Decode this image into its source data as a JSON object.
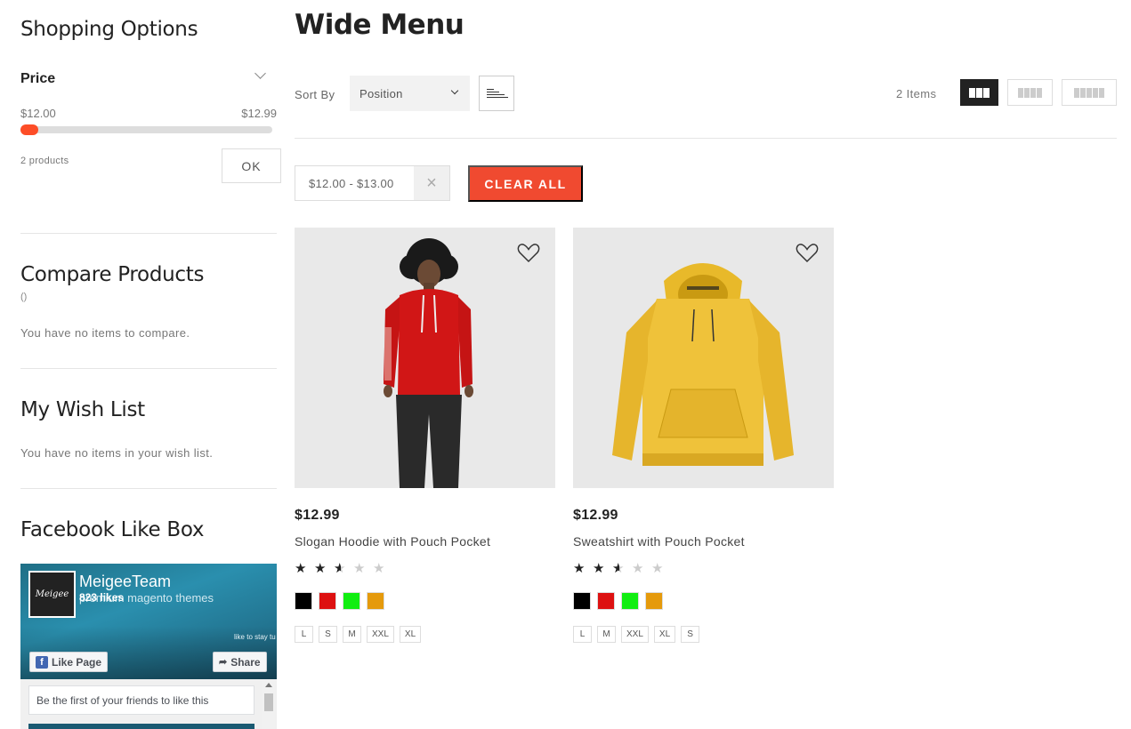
{
  "sidebar": {
    "shopping_options_title": "Shopping Options",
    "price_filter": {
      "label": "Price",
      "min": "$12.00",
      "max": "$12.99",
      "products_found": "2 products",
      "ok_label": "OK"
    },
    "compare": {
      "title": "Compare Products",
      "count": "()",
      "empty_message": "You have no items to compare."
    },
    "wishlist": {
      "title": "My Wish List",
      "empty_message": "You have no items in your wish list."
    },
    "facebook": {
      "title": "Facebook Like Box",
      "page_name": "MeigeeTeam",
      "logo_text": "Meigee",
      "tagline": "premium magento themes",
      "likes": "823 likes",
      "hint": "like to stay tu",
      "like_label": "Like Page",
      "share_label": "Share",
      "friends_text": "Be the first of your friends to like this"
    }
  },
  "main": {
    "title": "Wide Menu",
    "toolbar": {
      "sort_by_label": "Sort By",
      "sort_value": "Position",
      "items_count": "2 Items"
    },
    "active_filter": "$12.00 - $13.00",
    "clear_all_label": "CLEAR ALL",
    "products": [
      {
        "price": "$12.99",
        "name": "Slogan Hoodie with Pouch Pocket",
        "rating": 2.5,
        "rating_max": 5,
        "colors": [
          "#000000",
          "#dd1111",
          "#11ee11",
          "#e59a0c"
        ],
        "sizes": [
          "L",
          "S",
          "M",
          "XXL",
          "XL"
        ]
      },
      {
        "price": "$12.99",
        "name": "Sweatshirt with Pouch Pocket",
        "rating": 2.5,
        "rating_max": 5,
        "colors": [
          "#000000",
          "#dd1111",
          "#11ee11",
          "#e59a0c"
        ],
        "sizes": [
          "L",
          "M",
          "XXL",
          "XL",
          "S"
        ]
      }
    ]
  },
  "colors": {
    "accent": "#f04a30",
    "slider_handle": "#fd4d27",
    "facebook_blue": "#4267b2"
  },
  "icons": {
    "sort_direction": "sort-descending-icon",
    "grid_3": "grid-3-icon",
    "grid_4": "grid-4-icon",
    "grid_5": "grid-5-icon",
    "wishlist": "heart-icon",
    "remove_filter": "close-icon"
  }
}
